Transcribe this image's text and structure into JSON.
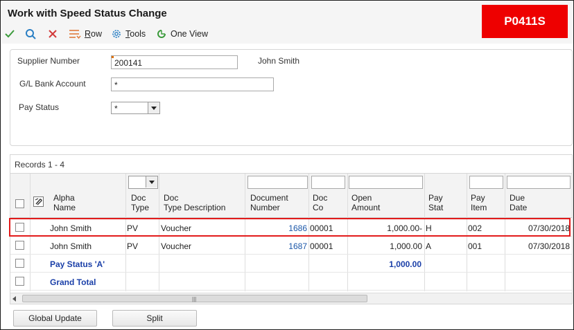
{
  "window": {
    "title": "Work with Speed Status Change",
    "program_badge": "P0411S"
  },
  "toolbar": {
    "items": [
      {
        "name": "ok-check",
        "label": ""
      },
      {
        "name": "find",
        "label": ""
      },
      {
        "name": "cancel",
        "label": ""
      },
      {
        "name": "row",
        "label": "Row",
        "underline": "R"
      },
      {
        "name": "tools",
        "label": "Tools",
        "underline": "T"
      },
      {
        "name": "one-view",
        "label": "One View"
      }
    ],
    "row_label_rest": "ow",
    "tools_label_rest": "ools",
    "row_underline": "R",
    "tools_underline": "T",
    "one_view_label": "One View"
  },
  "filters": {
    "supplier_number_label": "Supplier Number",
    "supplier_number_value": "200141",
    "supplier_name": "John Smith",
    "gl_bank_account_label": "G/L Bank Account",
    "gl_bank_account_value": "*",
    "pay_status_label": "Pay Status",
    "pay_status_value": "*"
  },
  "grid": {
    "records_label": "Records 1 - 4",
    "headers": {
      "alpha_name": [
        "Alpha",
        "Name"
      ],
      "doc_type": [
        "Doc",
        "Type"
      ],
      "doc_type_desc": [
        "Doc",
        "Type Description"
      ],
      "document_number": [
        "Document",
        "Number"
      ],
      "doc_co": [
        "Doc",
        "Co"
      ],
      "open_amount": [
        "Open",
        "Amount"
      ],
      "pay_stat": [
        "Pay",
        "Stat"
      ],
      "pay_item": [
        "Pay",
        "Item"
      ],
      "due_date": [
        "Due",
        "Date"
      ]
    },
    "rows": [
      {
        "alpha_name": "John Smith",
        "doc_type": "PV",
        "doc_type_desc": "Voucher",
        "document_number": "1686",
        "doc_co": "00001",
        "open_amount": "1,000.00-",
        "pay_stat": "H",
        "pay_item": "002",
        "due_date": "07/30/2018",
        "highlighted": true
      },
      {
        "alpha_name": "John Smith",
        "doc_type": "PV",
        "doc_type_desc": "Voucher",
        "document_number": "1687",
        "doc_co": "00001",
        "open_amount": "1,000.00",
        "pay_stat": "A",
        "pay_item": "001",
        "due_date": "07/30/2018"
      }
    ],
    "subtotal": {
      "label": "Pay Status 'A'",
      "amount": "1,000.00"
    },
    "grand_total": {
      "label": "Grand Total"
    }
  },
  "buttons": {
    "global_update": "Global Update",
    "split": "Split"
  },
  "colors": {
    "badge": "#ee0000",
    "highlight_border": "#e21a1a",
    "link": "#1a56a8",
    "total_text": "#1a3fa8"
  }
}
